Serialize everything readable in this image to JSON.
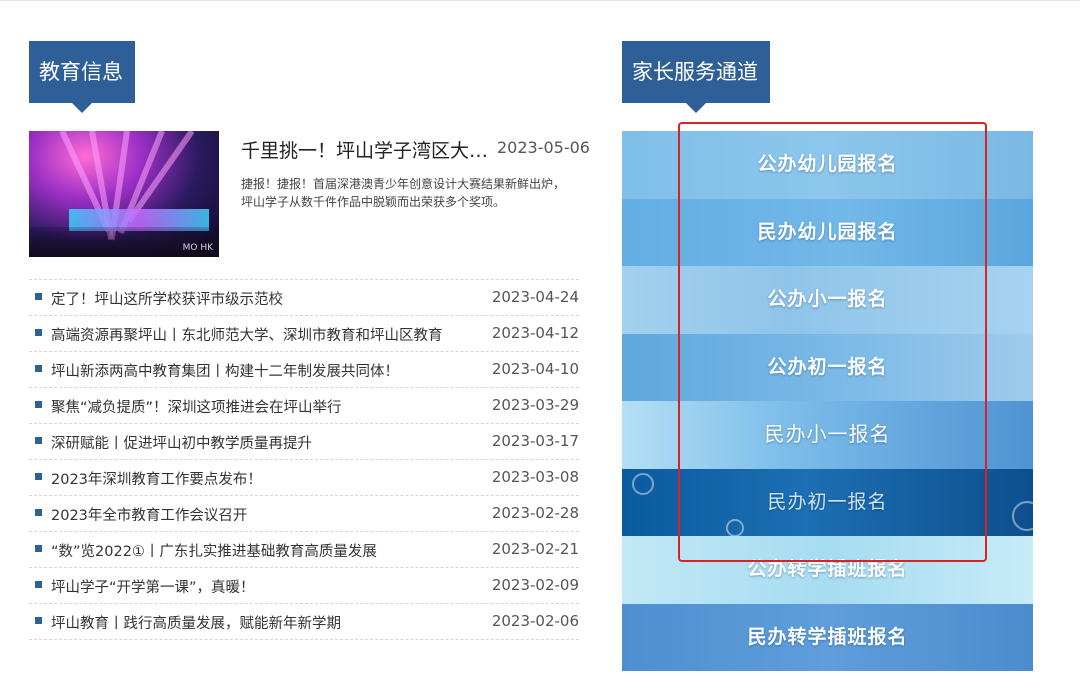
{
  "left_section": {
    "heading": "教育信息",
    "featured": {
      "image_alt": "event-stage-photo",
      "image_watermark": "MO HK",
      "title": "千里挑一！坪山学子湾区大赛载誉归来",
      "date": "2023-05-06",
      "summary": "捷报！捷报！首届深港澳青少年创意设计大赛结果新鲜出炉，坪山学子从数千件作品中脱颖而出荣获多个奖项。"
    },
    "news": [
      {
        "title": "定了！坪山这所学校获评市级示范校",
        "date": "2023-04-24"
      },
      {
        "title": "高端资源再聚坪山丨东北师范大学、深圳市教育和坪山区教育",
        "date": "2023-04-12"
      },
      {
        "title": "坪山新添两高中教育集团丨构建十二年制发展共同体！",
        "date": "2023-04-10"
      },
      {
        "title": "聚焦“减负提质”！深圳这项推进会在坪山举行",
        "date": "2023-03-29"
      },
      {
        "title": "深研赋能丨促进坪山初中教学质量再提升",
        "date": "2023-03-17"
      },
      {
        "title": "2023年深圳教育工作要点发布！",
        "date": "2023-03-08"
      },
      {
        "title": "2023年全市教育工作会议召开",
        "date": "2023-02-28"
      },
      {
        "title": "“数”览2022①丨广东扎实推进基础教育高质量发展",
        "date": "2023-02-21"
      },
      {
        "title": "坪山学子“开学第一课”，真暖！",
        "date": "2023-02-09"
      },
      {
        "title": "坪山教育丨践行高质量发展，赋能新年新学期",
        "date": "2023-02-06"
      }
    ]
  },
  "right_section": {
    "heading": "家长服务通道",
    "buttons": [
      {
        "label": "公办幼儿园报名"
      },
      {
        "label": "民办幼儿园报名"
      },
      {
        "label": "公办小一报名"
      },
      {
        "label": "公办初一报名"
      },
      {
        "label": "民办小一报名"
      },
      {
        "label": "民办初一报名"
      },
      {
        "label": "公办转学插班报名"
      },
      {
        "label": "民办转学插班报名"
      }
    ],
    "highlight_color": "#e02020"
  },
  "colors": {
    "accent": "#2e5f97",
    "bullet": "#2e5f97"
  }
}
